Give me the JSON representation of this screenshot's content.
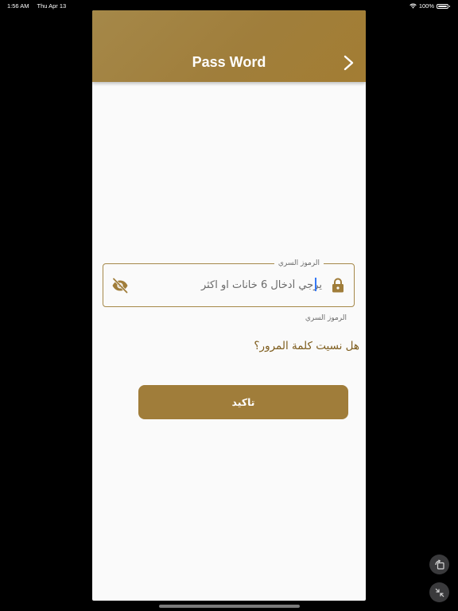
{
  "status_bar": {
    "time": "1:56 AM",
    "date": "Thu Apr 13",
    "battery": "100%"
  },
  "app_bar": {
    "title": "Pass Word"
  },
  "password_field": {
    "label": "الرموز السري",
    "placeholder": "يرجي أدخال 6 خانات او اكثر",
    "helper": "الرموز السري"
  },
  "forgot_password": {
    "label": "هل نسيت كلمة المرور؟"
  },
  "confirm_button": {
    "label": "تاكيد"
  },
  "colors": {
    "primary": "#a07d3a",
    "link": "#7d5c1c",
    "caret": "#3478f6"
  }
}
